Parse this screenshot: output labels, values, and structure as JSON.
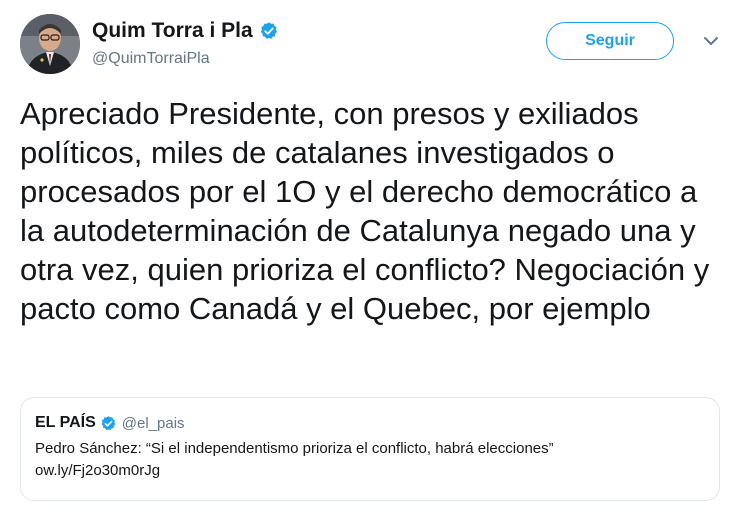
{
  "author": {
    "display_name": "Quim Torra i Pla",
    "handle": "@QuimTorraiPla",
    "verified": true,
    "avatar_icon": "portrait-photo"
  },
  "actions": {
    "follow_label": "Seguir",
    "menu_icon": "chevron-down-icon"
  },
  "tweet": {
    "text": "Apreciado Presidente, con presos y exiliados políticos, miles de catalanes investigados o procesados por el 1O y el derecho democrático a la autodeterminación de Catalunya negado una y otra vez, quien prioriza el conflicto? Negociación y pacto como Canadá y el Quebec, por ejemplo"
  },
  "quoted_tweet": {
    "display_name": "EL PAÍS",
    "handle": "@el_pais",
    "verified": true,
    "text": "Pedro Sánchez: “Si el independentismo prioriza el conflicto, habrá elecciones”",
    "link": "ow.ly/Fj2o30m0rJg"
  },
  "colors": {
    "accent": "#1da1f2",
    "secondary_text": "#657786",
    "border": "#e1e8ed"
  }
}
